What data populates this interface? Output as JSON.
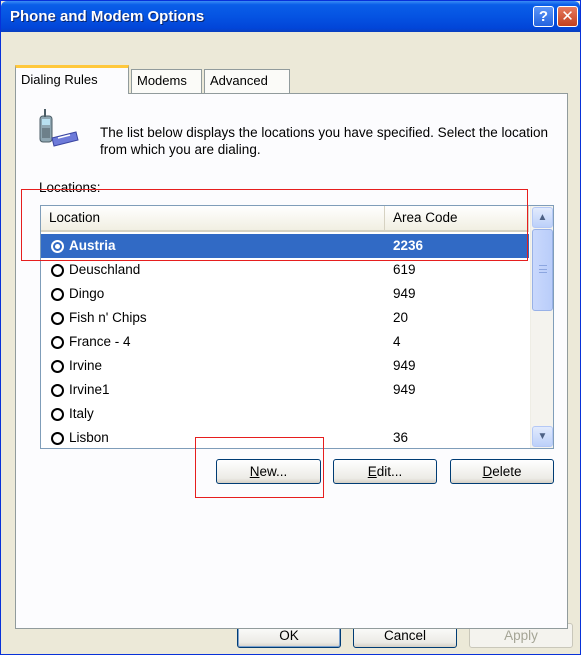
{
  "window": {
    "title": "Phone and Modem Options",
    "help_glyph": "?",
    "close_glyph": "✕"
  },
  "tabs": [
    {
      "label": "Dialing Rules",
      "active": true
    },
    {
      "label": "Modems",
      "active": false
    },
    {
      "label": "Advanced",
      "active": false
    }
  ],
  "dialing_rules": {
    "icon": "telephone-icon",
    "description": "The list below displays the locations you have specified. Select the location from which you are dialing.",
    "locations_label": "Locations:",
    "columns": [
      "Location",
      "Area Code"
    ],
    "rows": [
      {
        "location": "Austria",
        "area_code": "2236",
        "selected": true
      },
      {
        "location": "Deuschland",
        "area_code": "619",
        "selected": false
      },
      {
        "location": "Dingo",
        "area_code": "949",
        "selected": false
      },
      {
        "location": "Fish n' Chips",
        "area_code": "20",
        "selected": false
      },
      {
        "location": "France - 4",
        "area_code": "4",
        "selected": false
      },
      {
        "location": "Irvine",
        "area_code": "949",
        "selected": false
      },
      {
        "location": "Irvine1",
        "area_code": "949",
        "selected": false
      },
      {
        "location": "Italy",
        "area_code": "",
        "selected": false
      },
      {
        "location": "Lisbon",
        "area_code": "36",
        "selected": false
      }
    ],
    "buttons": {
      "new": {
        "mnemonic": "N",
        "rest": "ew..."
      },
      "edit": {
        "mnemonic": "E",
        "rest": "dit..."
      },
      "delete": {
        "mnemonic": "D",
        "rest": "elete"
      }
    }
  },
  "footer": {
    "ok": "OK",
    "cancel": "Cancel",
    "apply": "Apply"
  },
  "colors": {
    "titlebar": "#0553e2",
    "selection": "#316ac5",
    "highlight_annotation": "#e61e1e"
  }
}
